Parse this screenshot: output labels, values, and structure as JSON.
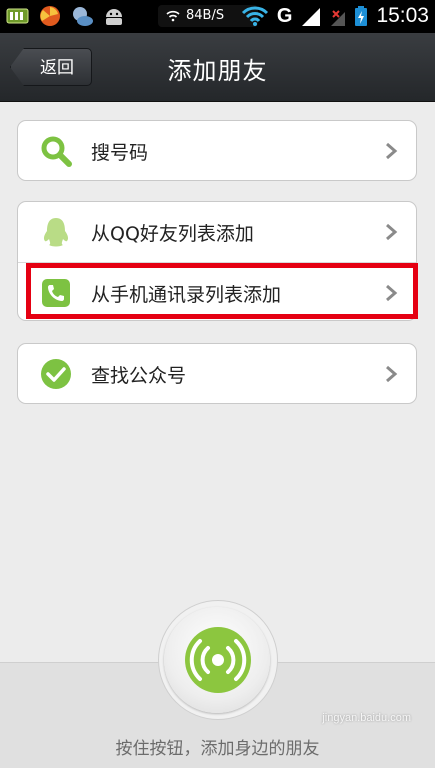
{
  "status_bar": {
    "speed": "84B/S",
    "network_type": "G",
    "time": "15:03",
    "icons": [
      "battery-app-icon",
      "pinwheel-app-icon",
      "chat-app-icon",
      "android-icon",
      "wifi-icon",
      "signal-icon",
      "battery-charging-icon"
    ]
  },
  "header": {
    "back_label": "返回",
    "title": "添加朋友"
  },
  "menu": {
    "search_number": "搜号码",
    "add_from_qq": "从QQ好友列表添加",
    "add_from_contacts": "从手机通讯录列表添加",
    "find_public_account": "查找公众号"
  },
  "bottom": {
    "hint": "按住按钮，添加身边的朋友"
  },
  "watermark": "jingyan.baidu.com",
  "colors": {
    "accent_green": "#7dc242",
    "highlight_red": "#e50012",
    "titlebar": "#2b2e32"
  }
}
